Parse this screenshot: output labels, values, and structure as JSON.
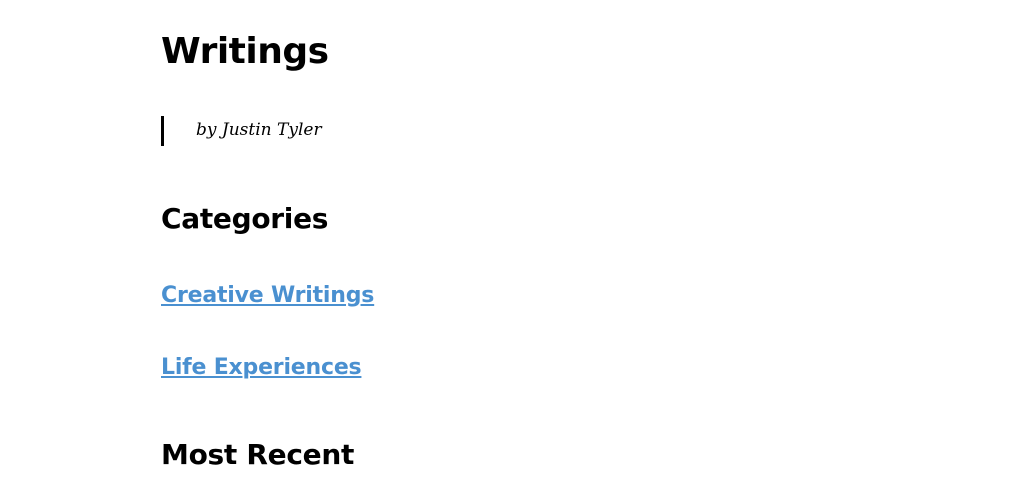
{
  "page": {
    "title": "Writings",
    "byline": "by Justin Tyler"
  },
  "categories": {
    "heading": "Categories",
    "links": [
      {
        "label": "Creative Writings"
      },
      {
        "label": "Life Experiences"
      }
    ]
  },
  "recent": {
    "heading": "Most Recent"
  },
  "colors": {
    "link": "#4a90d0",
    "text": "#000000",
    "background": "#ffffff"
  }
}
